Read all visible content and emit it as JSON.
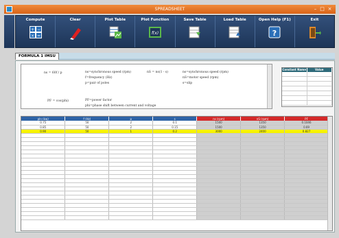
{
  "window": {
    "title": "SPREADSHEET"
  },
  "toolbar": {
    "buttons": [
      {
        "label": "Compute",
        "icon": "calculator-icon"
      },
      {
        "label": "Clear",
        "icon": "eraser-icon"
      },
      {
        "label": "Plot Table",
        "icon": "plot-table-icon"
      },
      {
        "label": "Plot Function",
        "icon": "plot-function-icon"
      },
      {
        "label": "Save Table",
        "icon": "save-table-icon"
      },
      {
        "label": "Load Table",
        "icon": "load-table-icon"
      },
      {
        "label": "Open Help (F1)",
        "icon": "help-icon"
      },
      {
        "label": "Exit",
        "icon": "exit-door-icon"
      }
    ]
  },
  "tabs": [
    {
      "label": "FORMULA 1 IMSU"
    }
  ],
  "formula": {
    "f1": "ns = 60f / p",
    "d1": "ns=synchronous speed (rpm)",
    "d2": "f=frequency (Hz)",
    "d3": "p=pair of poles",
    "f2": "nS = ns(1 - s)",
    "d4": "ns=synchronous speed (rpm)",
    "d5": "nS=motor speed (rpm)",
    "d6": "s=slip",
    "f3": "PF = cos(phi)",
    "d7": "PF=power factor",
    "d8": "phi=phase shift between current and voltage"
  },
  "constants": {
    "headers": [
      "Constant Name",
      "Value"
    ]
  },
  "table": {
    "headers": [
      "pIn (kw)",
      "f (Hz)",
      "p",
      "s",
      "ns (rpm)",
      "nS (rpm)",
      "PF"
    ],
    "header_colors": [
      "#2e63a6",
      "#2e63a6",
      "#2e63a6",
      "#2e63a6",
      "#d42a2a",
      "#d42a2a",
      "#d42a2a"
    ],
    "rows": [
      [
        "0.75",
        "50",
        "2",
        "0.1",
        "1500",
        "1350",
        "0.1046"
      ],
      [
        "0.85",
        "50",
        "2",
        "0.15",
        "1500",
        "1350",
        "0.69"
      ],
      [
        "0.90",
        "50",
        "1",
        "0.2",
        "3000",
        "2400",
        "0.827"
      ]
    ],
    "highlight_row": 2
  }
}
